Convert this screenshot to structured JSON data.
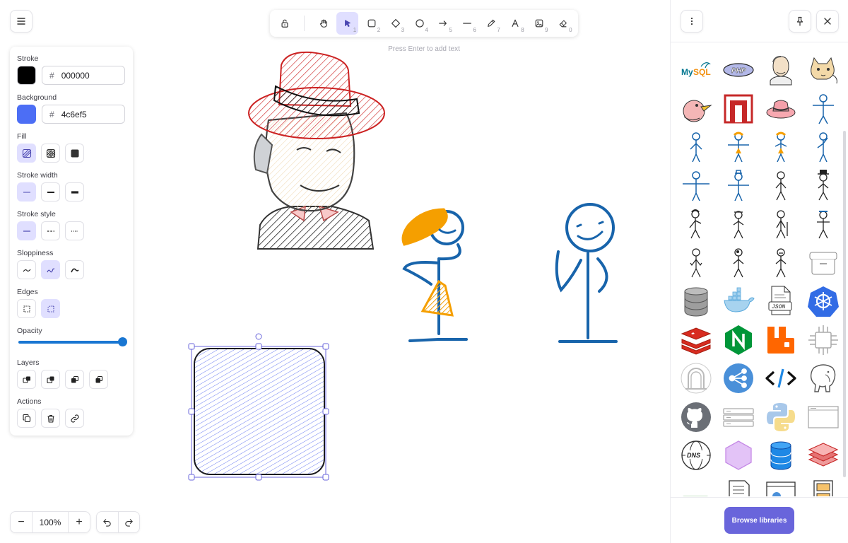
{
  "toolbar": {
    "tools": [
      {
        "id": "hand",
        "num": ""
      },
      {
        "id": "selection",
        "num": "1"
      },
      {
        "id": "rectangle",
        "num": "2"
      },
      {
        "id": "diamond",
        "num": "3"
      },
      {
        "id": "ellipse",
        "num": "4"
      },
      {
        "id": "arrow",
        "num": "5"
      },
      {
        "id": "line",
        "num": "6"
      },
      {
        "id": "draw",
        "num": "7"
      },
      {
        "id": "text",
        "num": "8"
      },
      {
        "id": "image",
        "num": "9"
      },
      {
        "id": "eraser",
        "num": "0"
      }
    ],
    "active_tool": "selection",
    "hint": "Press Enter to add text"
  },
  "properties": {
    "stroke_label": "Stroke",
    "stroke_hex": "000000",
    "stroke_color": "#000000",
    "background_label": "Background",
    "background_hex": "4c6ef5",
    "background_color": "#4c6ef5",
    "fill_label": "Fill",
    "stroke_width_label": "Stroke width",
    "stroke_style_label": "Stroke style",
    "sloppiness_label": "Sloppiness",
    "edges_label": "Edges",
    "opacity_label": "Opacity",
    "opacity_value": 100,
    "layers_label": "Layers",
    "actions_label": "Actions",
    "hash": "#"
  },
  "zoom": {
    "minus": "−",
    "plus": "+",
    "value": "100%"
  },
  "library": {
    "browse_label": "Browse libraries"
  },
  "colors": {
    "accent": "#6965db",
    "selected_bg": "#e0dfff",
    "opacity_blue": "#1976d2"
  }
}
